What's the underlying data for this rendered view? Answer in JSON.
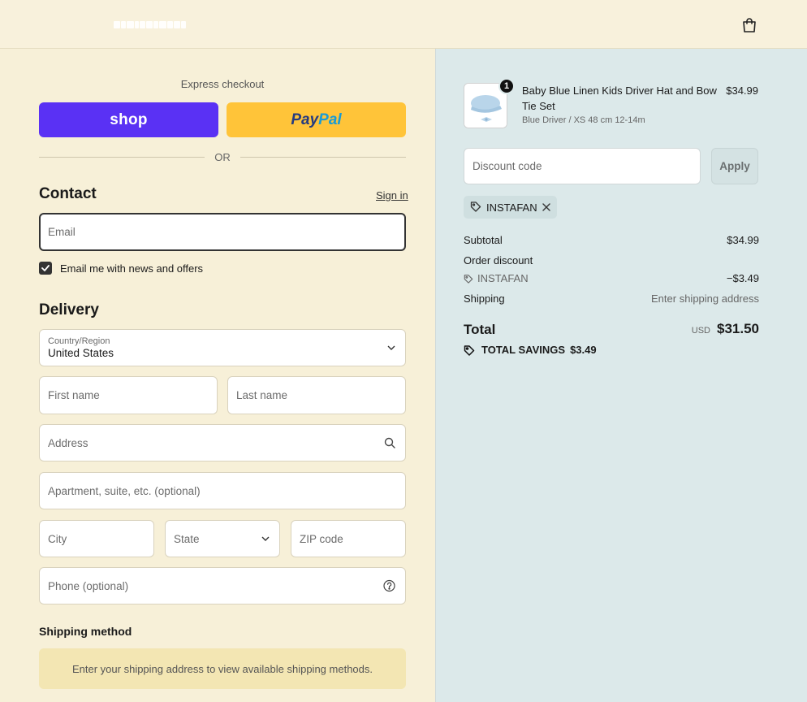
{
  "header": {
    "logo": "logo",
    "cart_icon": "shopping-bag-icon"
  },
  "express": {
    "label": "Express checkout",
    "shop_label": "shop",
    "paypal_part1": "Pay",
    "paypal_part2": "Pal",
    "or_label": "OR"
  },
  "contact": {
    "title": "Contact",
    "signin_label": "Sign in",
    "email_placeholder": "Email",
    "newsletter_label": "Email me with news and offers",
    "newsletter_checked": true
  },
  "delivery": {
    "title": "Delivery",
    "country_label": "Country/Region",
    "country_value": "United States",
    "first_name_placeholder": "First name",
    "last_name_placeholder": "Last name",
    "address_placeholder": "Address",
    "apartment_placeholder": "Apartment, suite, etc. (optional)",
    "city_placeholder": "City",
    "state_placeholder": "State",
    "zip_placeholder": "ZIP code",
    "phone_placeholder": "Phone (optional)"
  },
  "shipping_method": {
    "title": "Shipping method",
    "notice": "Enter your shipping address to view available shipping methods."
  },
  "order": {
    "item": {
      "quantity": "1",
      "name": "Baby Blue Linen Kids Driver Hat and Bow Tie Set",
      "variant": "Blue Driver / XS 48 cm 12-14m",
      "price": "$34.99"
    },
    "discount_placeholder": "Discount code",
    "apply_label": "Apply",
    "applied_code": "INSTAFAN",
    "summary": {
      "subtotal_label": "Subtotal",
      "subtotal_value": "$34.99",
      "order_discount_label": "Order discount",
      "discount_code": "INSTAFAN",
      "discount_value": "−$3.49",
      "shipping_label": "Shipping",
      "shipping_value": "Enter shipping address",
      "total_label": "Total",
      "total_currency": "USD",
      "total_value": "$31.50",
      "savings_label": "TOTAL SAVINGS",
      "savings_value": "$3.49"
    }
  },
  "colors": {
    "shop_purple": "#5a31f4",
    "paypal_yellow": "#ffc439",
    "left_bg": "#f7f0d8",
    "right_bg": "#dce9ea"
  }
}
